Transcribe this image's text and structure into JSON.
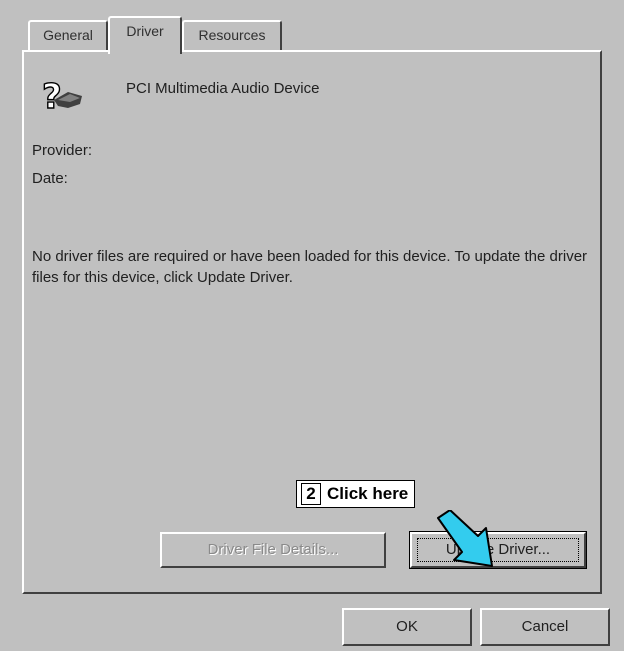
{
  "tabs": [
    {
      "label": "General"
    },
    {
      "label": "Driver"
    },
    {
      "label": "Resources"
    }
  ],
  "device": {
    "name": "PCI Multimedia Audio Device",
    "icon": "question-speaker-icon"
  },
  "fields": {
    "provider_label": "Provider:",
    "date_label": "Date:"
  },
  "message": "No driver files are required or have been loaded for this device.  To update the driver files for this device, click Update Driver.",
  "buttons": {
    "details": "Driver File Details...",
    "update": "Update Driver...",
    "ok": "OK",
    "cancel": "Cancel"
  },
  "callout": {
    "step": "2",
    "text": "Click here",
    "arrow_color": "#33ccee"
  }
}
